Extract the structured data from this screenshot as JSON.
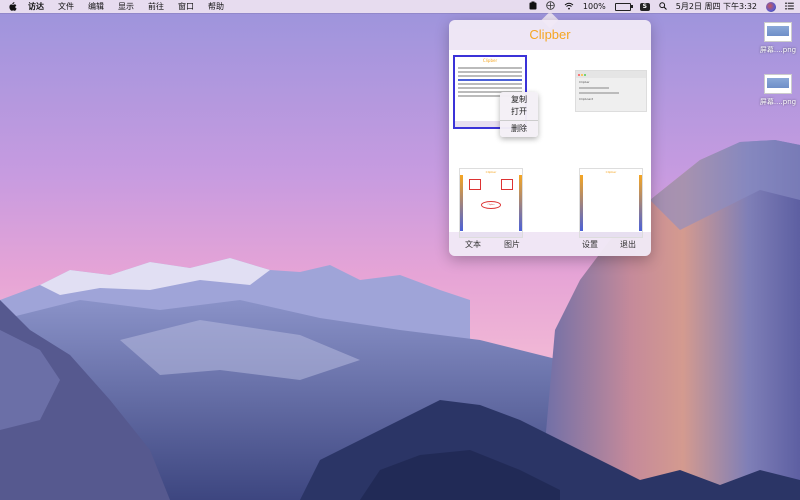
{
  "menubar": {
    "app_name": "访达",
    "items": [
      "文件",
      "编辑",
      "显示",
      "前往",
      "窗口",
      "帮助"
    ],
    "battery_percent": "100%",
    "datetime": "5月2日 周四 下午3:32"
  },
  "desktop": {
    "files": [
      {
        "label": "屏幕....png"
      },
      {
        "label": "屏幕....png"
      }
    ]
  },
  "popover": {
    "title": "Clipber",
    "title_color": "#f5a623",
    "footer": {
      "text_tab": "文本",
      "image_tab": "图片",
      "settings": "设置",
      "quit": "退出"
    },
    "thumb_texts": {
      "mini_title": "Clipber",
      "mini_badge": "Clipber",
      "mini_label1": "Clipber",
      "mini_label2": "Clipboard"
    }
  },
  "context_menu": {
    "items": [
      "复制",
      "打开",
      "删除"
    ]
  },
  "colors": {
    "selection": "#3b33d8",
    "accent": "#f5a623"
  }
}
